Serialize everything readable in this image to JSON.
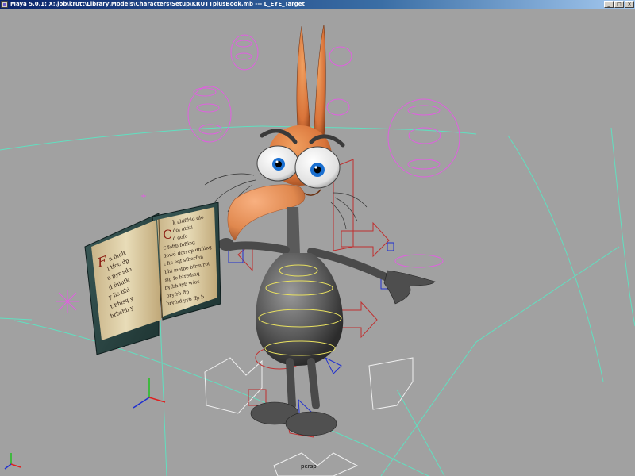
{
  "window": {
    "title": "Maya 5.0.1: X:\\job\\krutt\\Library\\Models\\Characters\\Setup\\KRUTTplusBook.mb  ---  L_EYE_Target",
    "controls": {
      "minimize": "_",
      "maximize": "□",
      "close": "×"
    }
  },
  "viewport": {
    "camera_label": "persp",
    "background_color": "#a1a1a1",
    "book_text": {
      "left_page": [
        "F",
        "a fiiolt",
        "i tfoc dp",
        "a pyr sdo",
        "d fuiutk",
        "y lis bhi",
        "t bhisq y",
        "brbshb y"
      ],
      "right_page": [
        "C",
        "ǩ aldfibio dlo",
        "dol atfiti",
        "d dofo",
        "Ɛ fofib foffing",
        "dowd dorrop dhfiing",
        "ɛ fic eqf stherfen",
        "bhl mefbe bfrm rot",
        "sig fe btredmq",
        "byfbh ŧyb wioc",
        "bryfrb ffp",
        "bryfnd yyb ffp b"
      ]
    },
    "colors": {
      "control_magenta": "#e060e0",
      "control_red": "#c03030",
      "control_blue": "#2030d0",
      "control_yellow": "#e8e060",
      "control_white": "#f0f0f0",
      "joint_cyan": "#60e0c0"
    }
  }
}
